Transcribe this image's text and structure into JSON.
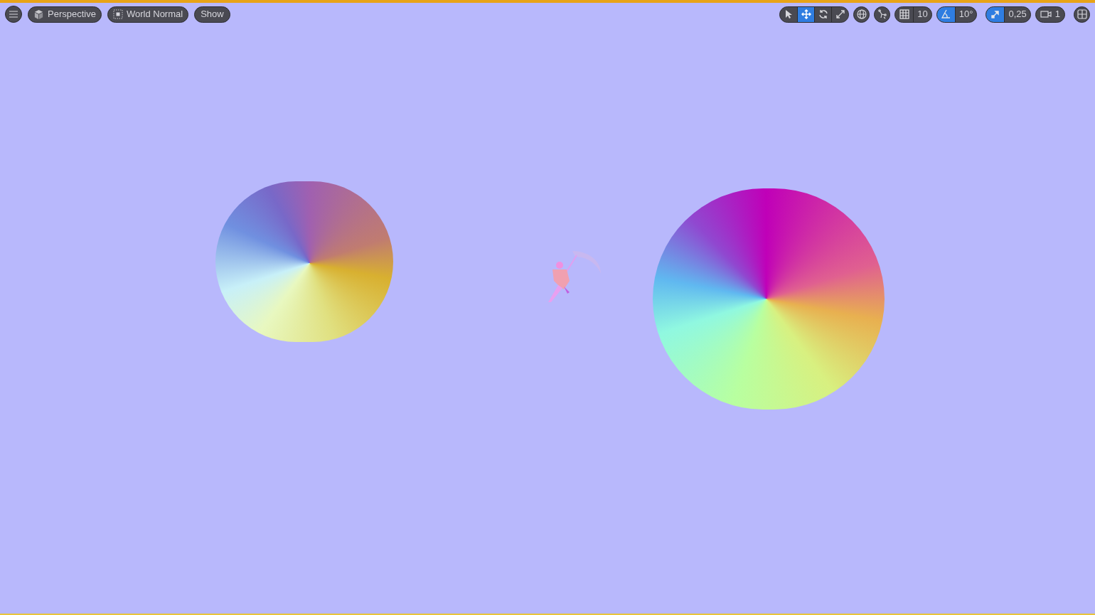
{
  "left_toolbar": {
    "view_mode": "Perspective",
    "view_mode_lighting": "World Normal",
    "show": "Show"
  },
  "transform_tools": [
    {
      "kind": "select",
      "selected": false
    },
    {
      "kind": "move",
      "selected": true
    },
    {
      "kind": "rotate",
      "selected": false
    },
    {
      "kind": "scale",
      "selected": false
    }
  ],
  "snaps": [
    {
      "kind": "grid",
      "value": "10",
      "enabled": false
    },
    {
      "kind": "angle",
      "value": "10°",
      "enabled": true
    },
    {
      "kind": "scale",
      "value": "0,25",
      "enabled": true
    }
  ],
  "camera_speed": "1"
}
